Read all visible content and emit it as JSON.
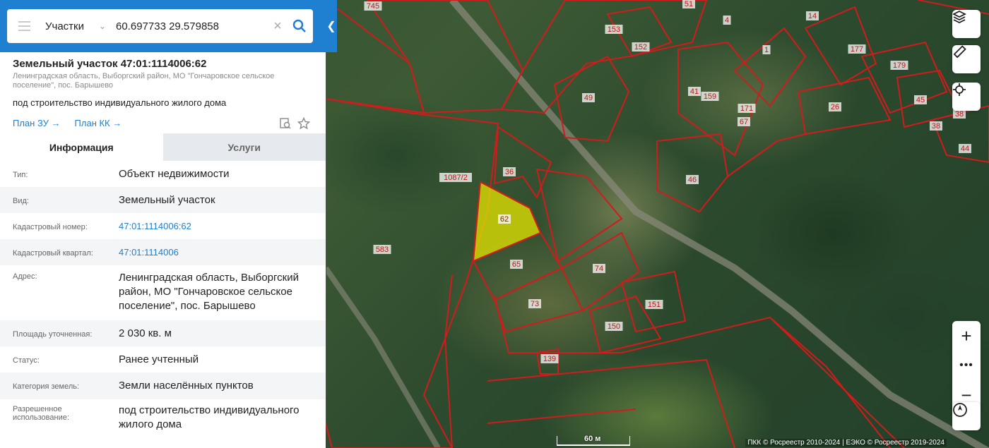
{
  "search": {
    "category": "Участки",
    "query": "60.697733 29.579858"
  },
  "card": {
    "title": "Земельный участок 47:01:1114006:62",
    "address_short": "Ленинградская область, Выборгский район, МО \"Гончаровское сельское поселение\", пос. Барышево",
    "permitted_use": "под строительство индивидуального жилого дома",
    "links": [
      "План ЗУ →",
      "План КК →"
    ]
  },
  "tabs": [
    "Информация",
    "Услуги"
  ],
  "info": [
    {
      "k": "Тип:",
      "v": "Объект недвижимости"
    },
    {
      "k": "Вид:",
      "v": "Земельный участок"
    },
    {
      "k": "Кадастровый номер:",
      "v": "47:01:1114006:62"
    },
    {
      "k": "Кадастровый квартал:",
      "v": "47:01:1114006"
    },
    {
      "k": "Адрес:",
      "v": "Ленинградская область, Выборгский район, МО \"Гончаровское сельское поселение\", пос. Барышево"
    },
    {
      "k": "Площадь уточненная:",
      "v": "2 030 кв. м"
    },
    {
      "k": "Статус:",
      "v": "Ранее учтенный"
    },
    {
      "k": "Категория земель:",
      "v": "Земли населённых пунктов"
    },
    {
      "k": "Разрешенное использование:",
      "v": "под строительство индивидуального жилого дома"
    }
  ],
  "map": {
    "parcel_labels": [
      "745",
      "51",
      "4",
      "14",
      "153",
      "152",
      "1",
      "177",
      "179",
      "41",
      "159",
      "171",
      "67",
      "26",
      "45",
      "38",
      "49",
      "38",
      "44",
      "36",
      "1087/2",
      "62",
      "46",
      "583",
      "65",
      "74",
      "73",
      "151",
      "150",
      "139"
    ],
    "scale_label": "60 м",
    "attribution": "ПКК © Росреестр 2010-2024 | ЕЭКО © Росреестр 2019-2024"
  },
  "colors": {
    "accent": "#1f7fd0",
    "parcel_border": "#d01c1c",
    "selected_parcel": "#e6e600"
  }
}
